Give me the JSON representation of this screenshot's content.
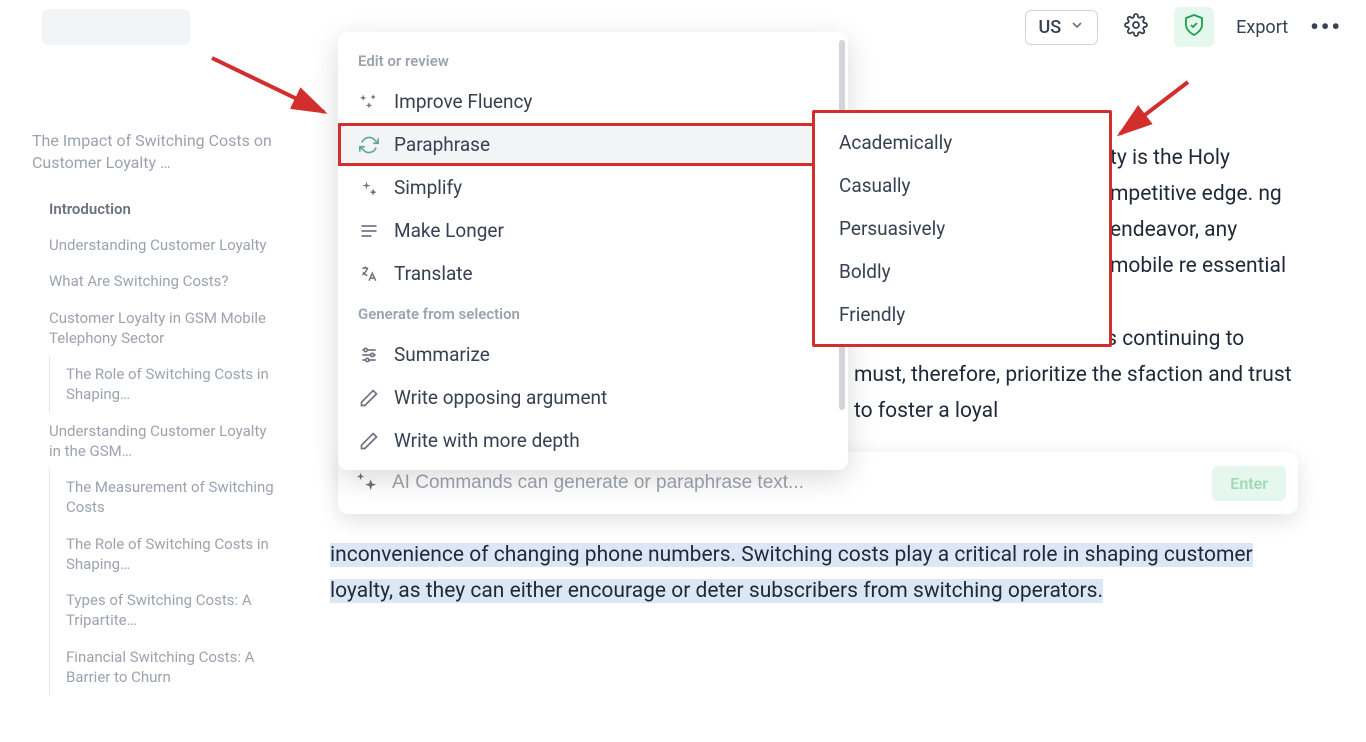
{
  "topbar": {
    "lang": "US",
    "export_label": "Export"
  },
  "sidebar": {
    "doc_title": "The Impact of Switching Costs on Customer Loyalty …",
    "items": [
      {
        "label": "Introduction",
        "bold": true,
        "level": 1
      },
      {
        "label": "Understanding Customer Loyalty",
        "level": 1
      },
      {
        "label": "What Are Switching Costs?",
        "level": 1
      },
      {
        "label": "Customer Loyalty in GSM Mobile Telephony Sector",
        "level": 1
      },
      {
        "label": "The Role of Switching Costs in Shaping…",
        "level": 2
      },
      {
        "label": "Understanding Customer Loyalty in the GSM…",
        "level": 1
      },
      {
        "label": "The Measurement of Switching Costs",
        "level": 2
      },
      {
        "label": "The Role of Switching Costs in Shaping…",
        "level": 2
      },
      {
        "label": "Types of Switching Costs: A Tripartite…",
        "level": 2
      },
      {
        "label": "Financial Switching Costs: A Barrier to Churn",
        "level": 2
      }
    ]
  },
  "main": {
    "text_fragment_1": "ty is the Holy mpetitive edge. ng endeavor, any mobile re essential ",
    "text_fragment_2": "the likelihood of subscribers continuing to must, therefore, prioritize the sfaction and trust to foster a loyal ",
    "text_fragment_3": "inconvenience of changing phone numbers. Switching costs play a critical role in shaping customer loyalty, as they can either encourage or deter subscribers from switching operators."
  },
  "popup": {
    "section_edit": "Edit or review",
    "section_generate": "Generate from selection",
    "items_edit": [
      {
        "label": "Improve Fluency",
        "icon": "sparkle-icon"
      },
      {
        "label": "Paraphrase",
        "icon": "refresh-icon",
        "selected": true,
        "highlight": true
      },
      {
        "label": "Simplify",
        "icon": "sparkle-plus-icon"
      },
      {
        "label": "Make Longer",
        "icon": "lines-icon"
      },
      {
        "label": "Translate",
        "icon": "translate-icon"
      }
    ],
    "items_generate": [
      {
        "label": "Summarize",
        "icon": "sliders-icon"
      },
      {
        "label": "Write opposing argument",
        "icon": "pencil-icon"
      },
      {
        "label": "Write with more depth",
        "icon": "pencil-icon"
      }
    ]
  },
  "submenu": {
    "items": [
      "Academically",
      "Casually",
      "Persuasively",
      "Boldly",
      "Friendly"
    ]
  },
  "command_bar": {
    "placeholder": "AI Commands can generate or paraphrase text...",
    "enter_label": "Enter"
  }
}
